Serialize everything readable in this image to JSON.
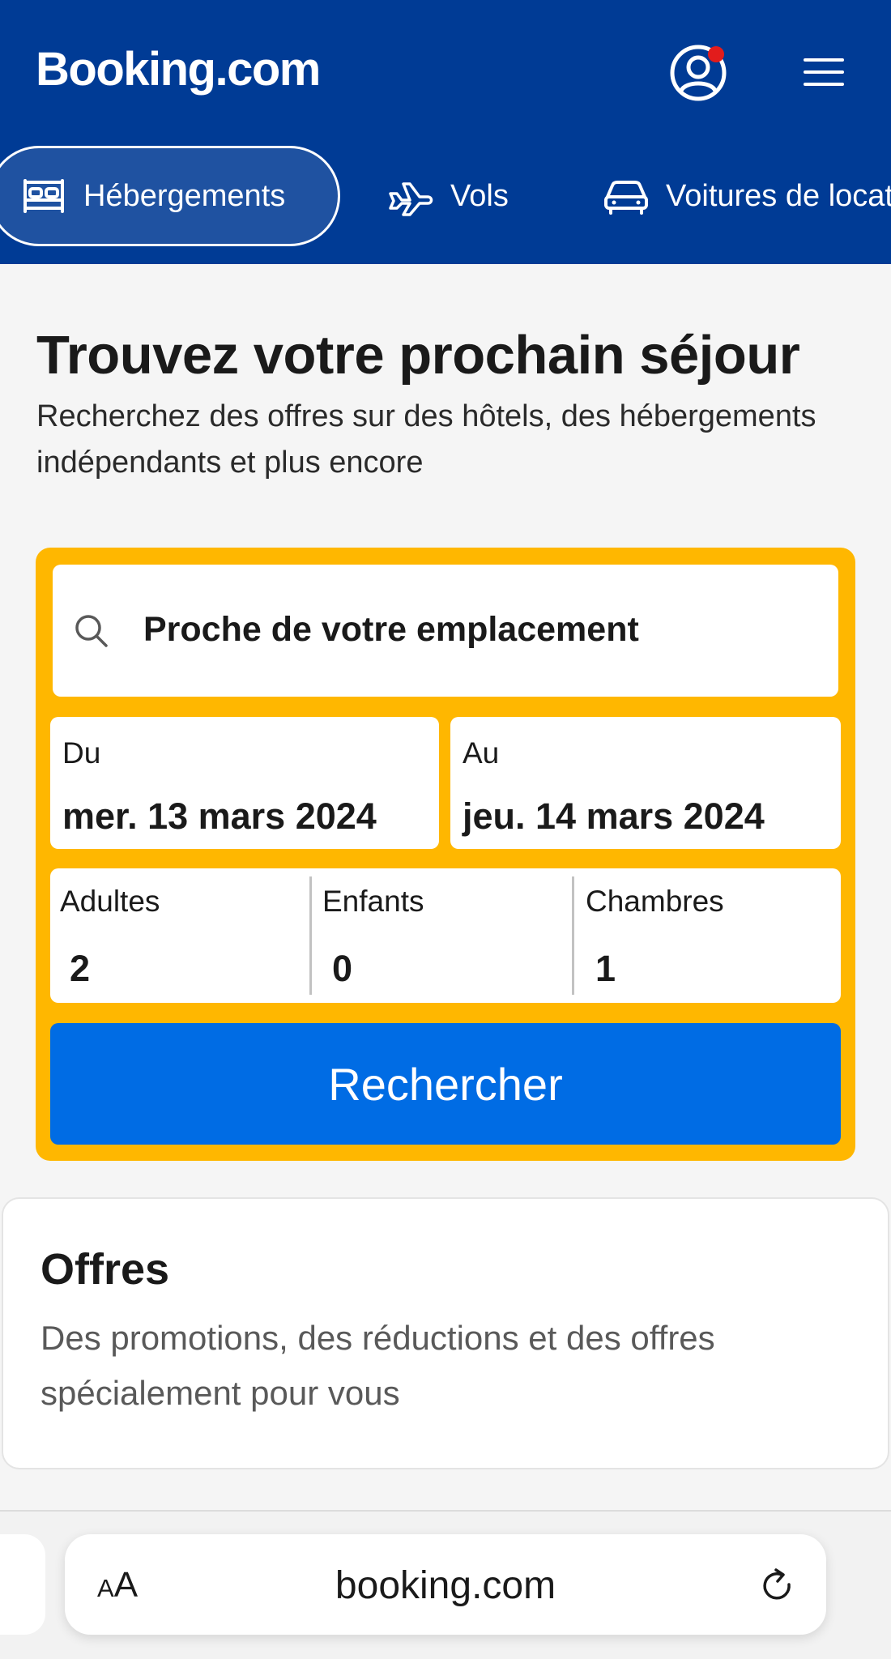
{
  "header": {
    "logo": "Booking.com",
    "colors": {
      "background": "#003b95",
      "notification": "#e21c1c"
    }
  },
  "tabs": [
    {
      "label": "Hébergements",
      "icon": "bed-icon",
      "active": true
    },
    {
      "label": "Vols",
      "icon": "airplane-icon",
      "active": false
    },
    {
      "label": "Voitures de location",
      "icon": "car-icon",
      "active": false
    }
  ],
  "hero": {
    "title": "Trouvez votre prochain séjour",
    "subtitle": "Recherchez des offres sur des hôtels, des hébergements indépendants et plus encore"
  },
  "search": {
    "destination": "Proche de votre emplacement",
    "from_label": "Du",
    "from_value": "mer. 13 mars 2024",
    "to_label": "Au",
    "to_value": "jeu. 14 mars 2024",
    "adults_label": "Adultes",
    "adults_value": "2",
    "children_label": "Enfants",
    "children_value": "0",
    "rooms_label": "Chambres",
    "rooms_value": "1",
    "button_label": "Rechercher",
    "colors": {
      "frame": "#ffb700",
      "button": "#006ce4"
    }
  },
  "offers": {
    "title": "Offres",
    "text": "Des promotions, des réductions et des offres spécialement pour vous"
  },
  "browser": {
    "aa_small": "A",
    "aa_large": "A",
    "url": "booking.com"
  }
}
